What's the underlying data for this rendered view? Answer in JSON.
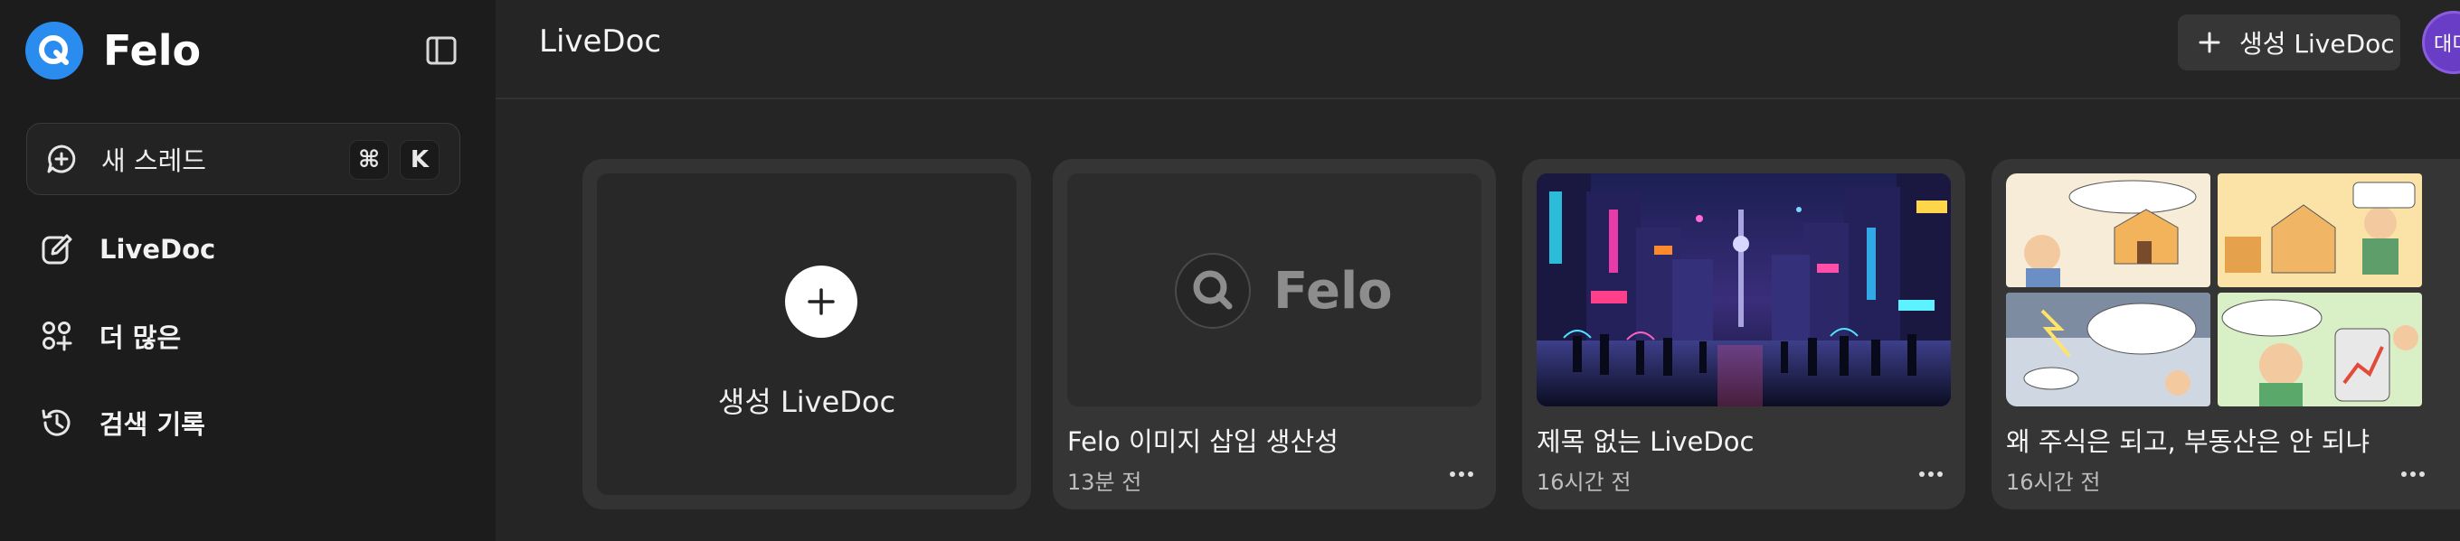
{
  "app": {
    "name": "Felo",
    "brand_color": "#2b8cf0"
  },
  "sidebar": {
    "new_thread": {
      "label": "새 스레드",
      "shortcut_keys": [
        "⌘",
        "K"
      ]
    },
    "items": [
      {
        "label": "LiveDoc",
        "icon": "edit-icon"
      },
      {
        "label": "더 많은",
        "icon": "apps-plus-icon"
      },
      {
        "label": "검색 기록",
        "icon": "history-icon"
      }
    ]
  },
  "header": {
    "title": "LiveDoc",
    "create_button_label": "생성 LiveDoc",
    "avatar_text": "대미"
  },
  "new_card": {
    "label": "생성 LiveDoc"
  },
  "docs": [
    {
      "title": "Felo 이미지 삽입 생산성",
      "time": "13분 전",
      "thumbnail": "felo-logo",
      "thumbnail_text": "Felo"
    },
    {
      "title": "제목 없는 LiveDoc",
      "time": "16시간 전",
      "thumbnail": "neon-city-night-street"
    },
    {
      "title": "왜 주식은 되고, 부동산은 안 되냐",
      "time": "16시간 전",
      "thumbnail": "comic-panels"
    }
  ]
}
